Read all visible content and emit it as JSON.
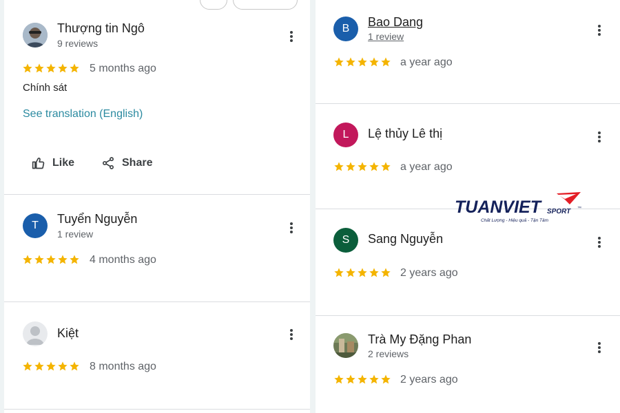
{
  "colors": {
    "star": "#f4b400",
    "link": "#2b8aa0",
    "avatar_T": "#1a5eab",
    "avatar_B": "#1a5eab",
    "avatar_L": "#c2185b",
    "avatar_S": "#0b5e3b"
  },
  "left_reviews": [
    {
      "name": "Thượng tin Ngô",
      "reviews": "9 reviews",
      "date": "5 months ago",
      "text": "Chính sát",
      "translation_link": "See translation (English)",
      "like_label": "Like",
      "share_label": "Share",
      "avatar_icon": "photo-avatar-icon"
    },
    {
      "name": "Tuyển Nguyễn",
      "reviews": "1 review",
      "date": "4 months ago",
      "avatar_letter": "T"
    },
    {
      "name": "Kiệt",
      "date": "8 months ago",
      "avatar_icon": "default-person-icon"
    }
  ],
  "right_reviews": [
    {
      "name": "Bao Dang",
      "reviews": "1 review",
      "date": "a year ago",
      "avatar_letter": "B"
    },
    {
      "name": "Lệ thủy Lê thị",
      "date": "a year ago",
      "avatar_letter": "L"
    },
    {
      "name": "Sang Nguyễn",
      "date": "2 years ago",
      "avatar_letter": "S"
    },
    {
      "name": "Trà My Đặng Phan",
      "reviews": "2 reviews",
      "date": "2 years ago",
      "avatar_icon": "photo-avatar-icon"
    }
  ],
  "watermark": {
    "brand": "TUANVIET",
    "sub": "SPORT",
    "tm": "™",
    "tagline": "Chất Lượng - Hiệu quả - Tận Tâm"
  },
  "rating_stars": 5
}
